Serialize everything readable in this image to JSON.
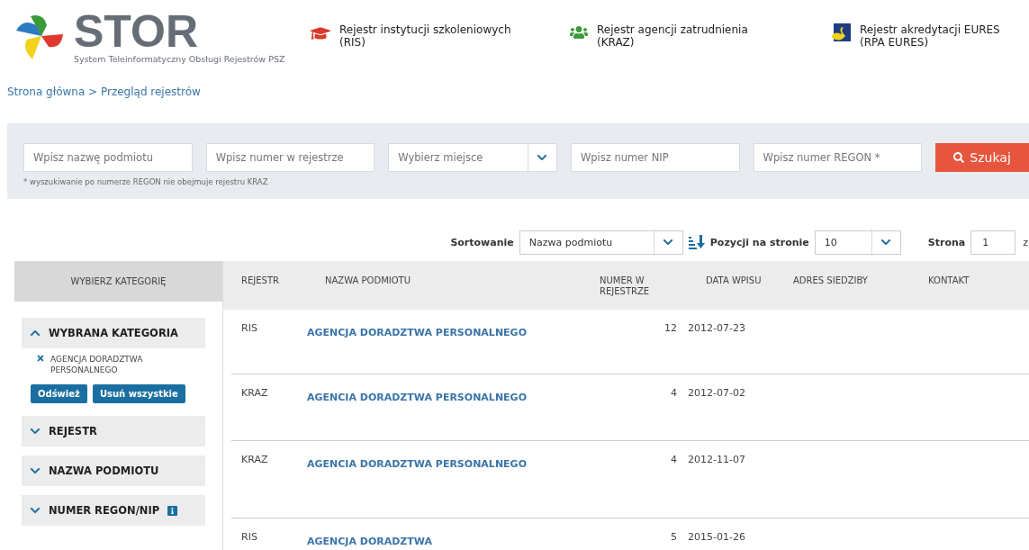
{
  "logo": {
    "name": "STOR",
    "subtitle": "System Teleinformatyczny Obsługi Rejestrów PSZ"
  },
  "registers": [
    {
      "kind": "ris",
      "line1": "Rejestr instytucji szkoleniowych",
      "line2": "(RIS)"
    },
    {
      "kind": "kraz",
      "line1": "Rejestr agencji zatrudnienia",
      "line2": "(KRAZ)"
    },
    {
      "kind": "eures",
      "line1": "Rejestr akredytacji EURES",
      "line2": "(RPA EURES)"
    }
  ],
  "breadcrumb": "Strona główna > Przegląd rejestrów",
  "search": {
    "fields": [
      {
        "kind": "text",
        "placeholder": "Wpisz nazwę podmiotu"
      },
      {
        "kind": "text",
        "placeholder": "Wpisz numer w rejestrze"
      },
      {
        "kind": "select",
        "placeholder": "Wybierz miejsce"
      },
      {
        "kind": "text",
        "placeholder": "Wpisz numer NIP"
      },
      {
        "kind": "text",
        "placeholder": "Wpisz numer REGON *"
      }
    ],
    "button": "Szukaj",
    "note": "* wyszukiwanie po numerze REGON nie obejmuje rejestru KRAZ"
  },
  "sorting": {
    "label": "Sortowanie",
    "value": "Nazwa podmiotu",
    "per_page_label": "Pozycji na stronie",
    "per_page": "10",
    "page_label": "Strona",
    "page": "1",
    "of": "z"
  },
  "sidebar": {
    "title": "WYBIERZ KATEGORIĘ",
    "sections": [
      {
        "title": "WYBRANA KATEGORIA",
        "expanded": true,
        "chips": [
          "AGENCJA DORADZTWA PERSONALNEGO"
        ],
        "buttons": [
          "Odśwież",
          "Usuń wszystkie"
        ]
      },
      {
        "title": "REJESTR",
        "expanded": false
      },
      {
        "title": "NAZWA PODMIOTU",
        "expanded": false
      },
      {
        "title": "NUMER REGON/NIP",
        "expanded": false,
        "info": true
      }
    ]
  },
  "table": {
    "columns": [
      "REJESTR",
      "NAZWA PODMIOTU",
      "NUMER W REJESTRZE",
      "DATA WPISU",
      "ADRES SIEDZIBY",
      "KONTAKT"
    ],
    "rows": [
      [
        "RIS",
        "AGENCJA DORADZTWA PERSONALNEGO",
        "12",
        "2012-07-23"
      ],
      [
        "KRAZ",
        "AGENCIA DORADZTWA PERSONALNEGO",
        "4",
        "2012-07-02"
      ],
      [
        "KRAZ",
        "AGENCIA DORADZTWA PERSONALNEGO",
        "4",
        "2012-11-07"
      ],
      [
        "RIS",
        "AGENCJA DORADZTWA",
        "5",
        "2015-01-26"
      ]
    ]
  }
}
